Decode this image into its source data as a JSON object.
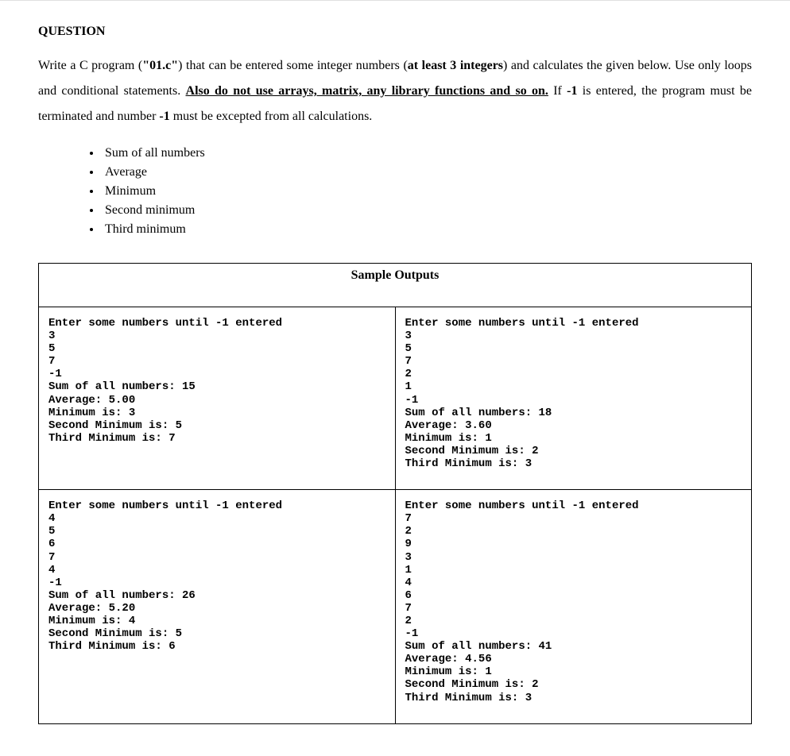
{
  "heading": "QUESTION",
  "para_runs": [
    {
      "t": "Write a C program ("
    },
    {
      "t": "\"01.c\"",
      "b": true
    },
    {
      "t": ") that can be entered some integer numbers ("
    },
    {
      "t": "at least 3 integers",
      "b": true
    },
    {
      "t": ") and calculates the given below. Use only loops and conditional statements. "
    },
    {
      "t": "Also do not use arrays, matrix, any library functions and so on.",
      "u": true
    },
    {
      "t": " If "
    },
    {
      "t": "-1",
      "b": true
    },
    {
      "t": " is entered, the program must be terminated and number "
    },
    {
      "t": "-1",
      "b": true
    },
    {
      "t": " must be excepted from all calculations."
    }
  ],
  "bullets": [
    "Sum of all numbers",
    "Average",
    "Minimum",
    "Second minimum",
    "Third minimum"
  ],
  "sample_title": "Sample Outputs",
  "outputs": [
    "Enter some numbers until -1 entered\n3\n5\n7\n-1\nSum of all numbers: 15\nAverage: 5.00\nMinimum is: 3\nSecond Minimum is: 5\nThird Minimum is: 7",
    "Enter some numbers until -1 entered\n3\n5\n7\n2\n1\n-1\nSum of all numbers: 18\nAverage: 3.60\nMinimum is: 1\nSecond Minimum is: 2\nThird Minimum is: 3",
    "Enter some numbers until -1 entered\n4\n5\n6\n7\n4\n-1\nSum of all numbers: 26\nAverage: 5.20\nMinimum is: 4\nSecond Minimum is: 5\nThird Minimum is: 6",
    "Enter some numbers until -1 entered\n7\n2\n9\n3\n1\n4\n6\n7\n2\n-1\nSum of all numbers: 41\nAverage: 4.56\nMinimum is: 1\nSecond Minimum is: 2\nThird Minimum is: 3"
  ]
}
